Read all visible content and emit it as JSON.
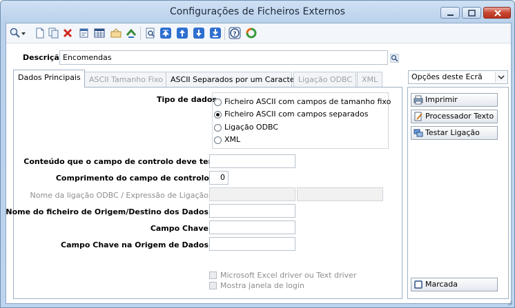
{
  "window": {
    "title": "Configurações de Ficheiros Externos"
  },
  "toolbar": {
    "icons": [
      "search-icon",
      "new-document-icon",
      "copy-icon",
      "delete-icon",
      "properties-icon",
      "grid-icon",
      "attachment-icon",
      "refresh-icon",
      "preview-icon",
      "first-record-icon",
      "previous-record-icon",
      "next-record-icon",
      "last-record-icon",
      "help-icon",
      "sync-icon"
    ]
  },
  "descricao": {
    "label": "Descrição",
    "value": "Encomendas"
  },
  "tabs": [
    {
      "label": "Dados Principais",
      "state": "active"
    },
    {
      "label": "ASCII Tamanho Fixo",
      "state": "disabled"
    },
    {
      "label": "ASCII Separados por um Caracter",
      "state": "normal"
    },
    {
      "label": "Ligação ODBC",
      "state": "disabled"
    },
    {
      "label": "XML",
      "state": "disabled"
    }
  ],
  "tipo_dados": {
    "label": "Tipo de dados",
    "options": [
      {
        "label": "Ficheiro ASCII com campos de tamanho fixo",
        "selected": false
      },
      {
        "label": "Ficheiro ASCII com campos separados",
        "selected": true
      },
      {
        "label": "Ligação ODBC",
        "selected": false
      },
      {
        "label": "XML",
        "selected": false
      }
    ]
  },
  "fields": {
    "conteudo_label": "Conteúdo que o campo de controlo deve ter",
    "conteudo_value": "",
    "comprimento_label": "Comprimento do campo de controlo",
    "comprimento_value": "0",
    "odbc_label": "Nome da ligação ODBC / Expressão de Ligação",
    "nome_ficheiro_label": "Nome do ficheiro de Origem/Destino dos Dados",
    "campo_chave_label": "Campo Chave",
    "campo_chave_origem_label": "Campo Chave na Origem de Dados"
  },
  "checks": [
    {
      "label": "Microsoft Excel driver ou Text driver",
      "checked": false
    },
    {
      "label": "Mostra janela de login",
      "checked": false
    }
  ],
  "options_panel": {
    "select_value": "Opções deste Ecrã",
    "buttons": [
      "Imprimir",
      "Processador Texto",
      "Testar Ligação"
    ],
    "marcada": "Marcada"
  }
}
